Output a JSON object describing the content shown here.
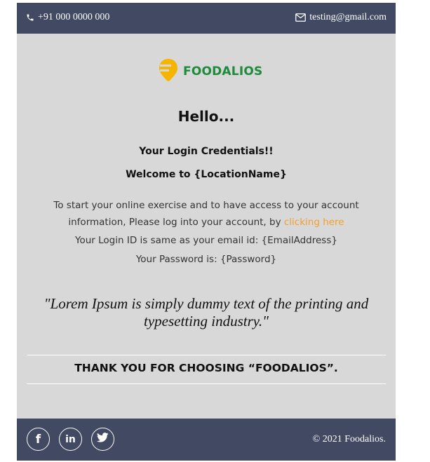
{
  "header": {
    "phone": "+91 000 0000 000",
    "email": "testing@gmail.com"
  },
  "logo": {
    "brand": "FOODALIOS",
    "accent_color": "#f5b400",
    "brand_color": "#1e8a3c"
  },
  "content": {
    "greeting": "Hello...",
    "credentials_heading": "Your Login Credentials!!",
    "welcome": "Welcome to {LocationName}",
    "intro_text": "To start your online exercise and to have access to your account information, Please log into your account, by ",
    "link_text": "clicking here",
    "login_id_text": "Your Login ID is same as your email id: {EmailAddress}",
    "password_text": "Your Password is: {Password}",
    "quote": "\"Lorem Ipsum is simply dummy text of the printing and typesetting industry.\"",
    "thanks": "THANK YOU FOR CHOOSING “FOODALIOS”."
  },
  "footer": {
    "social": [
      {
        "icon": "facebook-icon",
        "label": "f"
      },
      {
        "icon": "linkedin-icon",
        "label": "in"
      },
      {
        "icon": "twitter-icon",
        "label": ""
      }
    ],
    "copyright": "© 2021 Foodalios."
  },
  "colors": {
    "bar": "#424a63",
    "panel": "#d8d8d8",
    "link": "#f0a030"
  }
}
